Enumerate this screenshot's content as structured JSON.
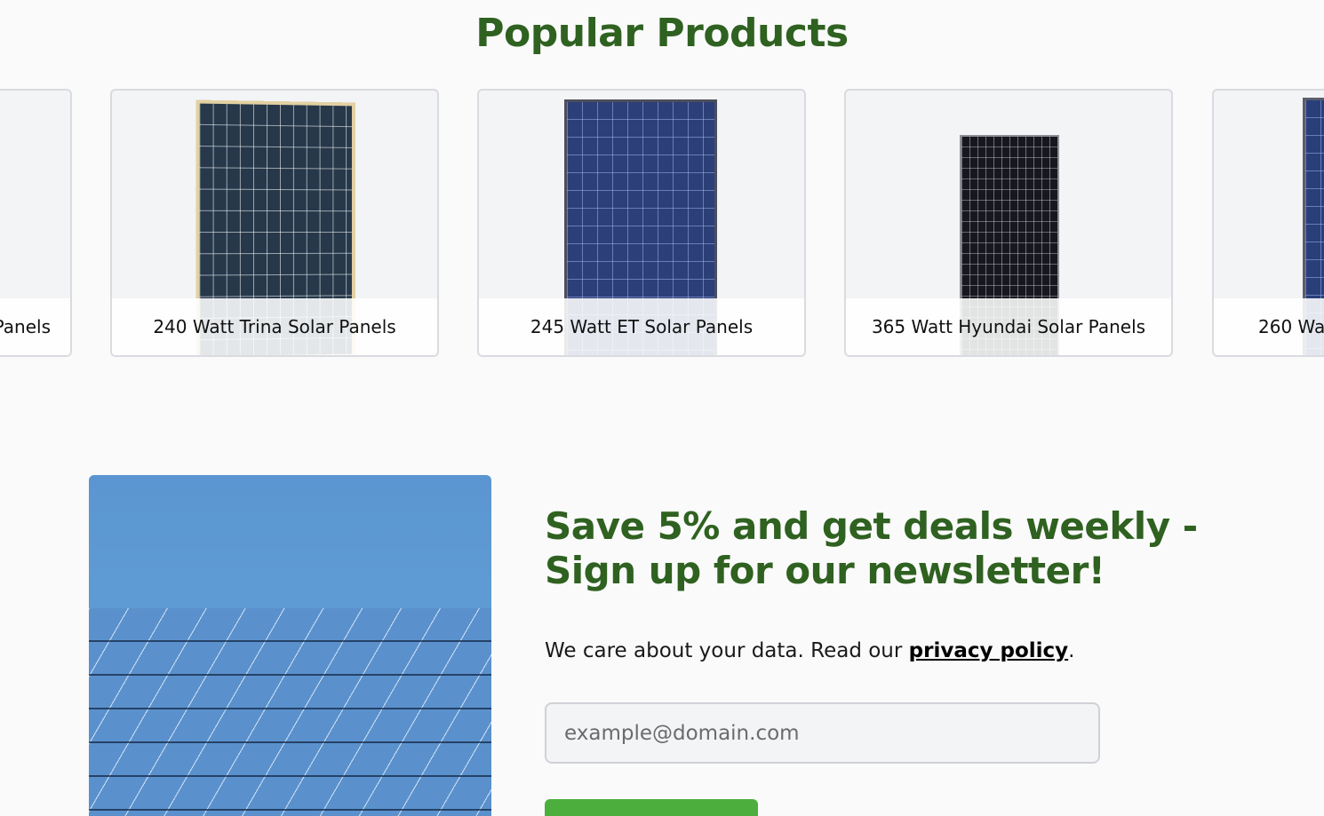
{
  "popular": {
    "title": "Popular Products",
    "products": [
      {
        "label": "Panels",
        "panel_style": "none"
      },
      {
        "label": "240 Watt Trina Solar Panels",
        "panel_style": "polycrystalline with gold frame"
      },
      {
        "label": "245 Watt ET Solar Panels",
        "panel_style": "blue polycrystalline"
      },
      {
        "label": "365 Watt Hyundai Solar Panels",
        "panel_style": "black monocrystalline"
      },
      {
        "label": "260 Wa",
        "panel_style": "blue polycrystalline"
      }
    ]
  },
  "newsletter": {
    "title": "Save 5% and get deals weekly - Sign up for our newsletter!",
    "text_before_link": "We care about your data. Read our ",
    "link_label": "privacy policy",
    "text_after_link": ".",
    "email_placeholder": "example@domain.com",
    "email_value": "",
    "submit_label": ""
  },
  "colors": {
    "heading": "#2f6120",
    "accent_button": "#4caf3d",
    "background": "#fafafa"
  }
}
